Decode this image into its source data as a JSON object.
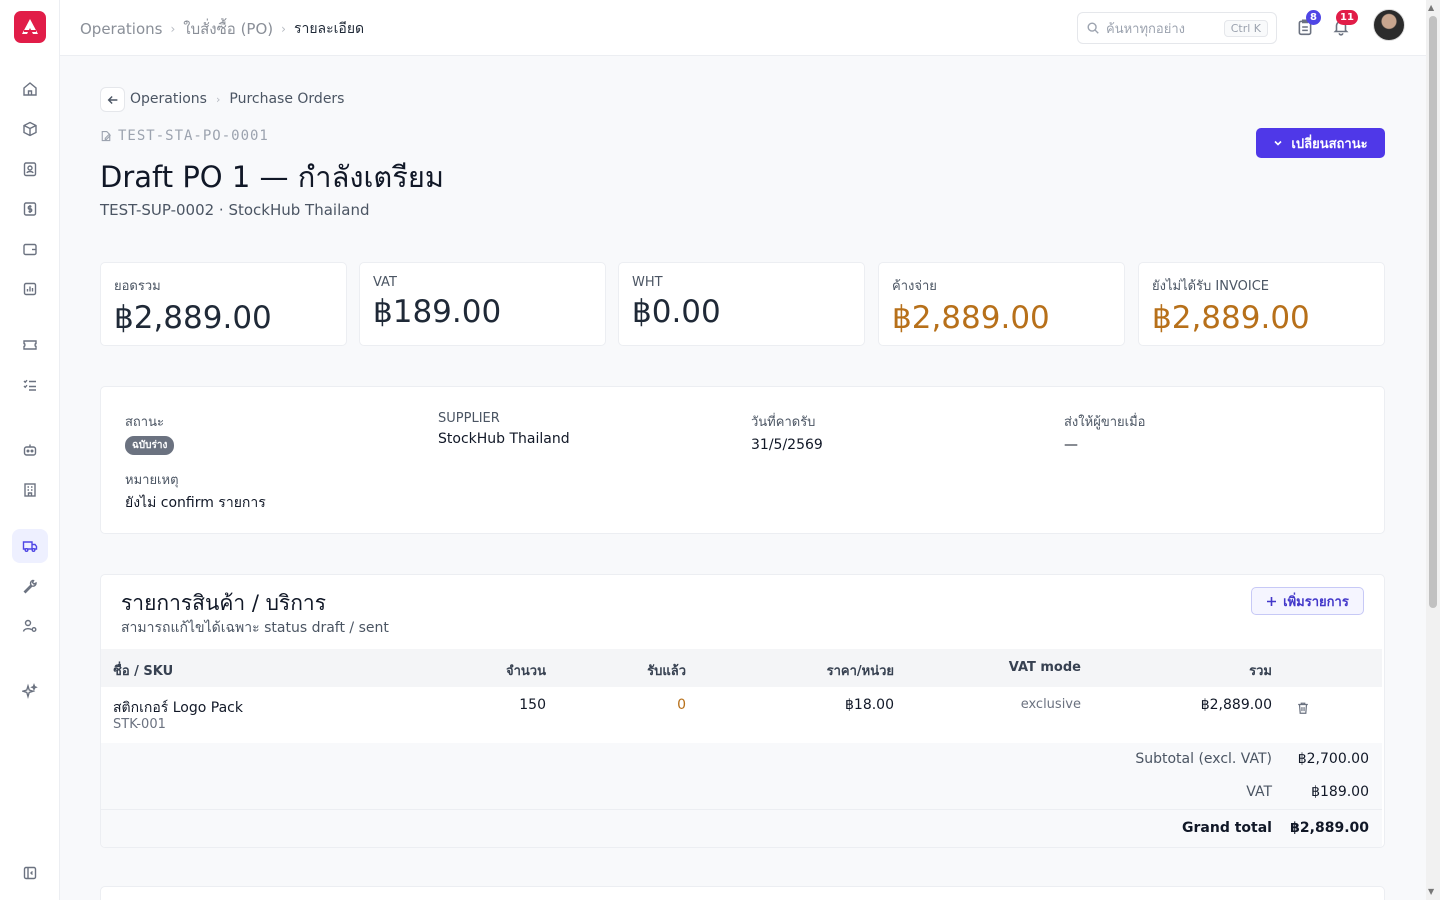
{
  "topbar": {
    "breadcrumbs": [
      "Operations",
      "ใบสั่งซื้อ (PO)",
      "รายละเอียด"
    ],
    "search_placeholder": "ค้นหาทุกอย่าง",
    "search_shortcut": "Ctrl K",
    "tasks_count": "8",
    "notifications_count": "11"
  },
  "page": {
    "sub_breadcrumbs": [
      "Operations",
      "Purchase Orders"
    ],
    "doc_number": "TEST-STA-PO-0001",
    "title": "Draft PO 1 — กำลังเตรียม",
    "subtitle": "TEST-SUP-0002 · StockHub Thailand",
    "change_status_label": "เปลี่ยนสถานะ"
  },
  "stats": [
    {
      "label": "ยอดรวม",
      "value": "฿2,889.00"
    },
    {
      "label": "VAT",
      "value": "฿189.00"
    },
    {
      "label": "WHT",
      "value": "฿0.00"
    },
    {
      "label": "ค้างจ่าย",
      "value": "฿2,889.00"
    },
    {
      "label": "ยังไม่ได้รับ INVOICE",
      "value": "฿2,889.00"
    }
  ],
  "info": {
    "status_label": "สถานะ",
    "status_value": "ฉบับร่าง",
    "supplier_label": "SUPPLIER",
    "supplier_value": "StockHub Thailand",
    "expected_label": "วันที่คาดรับ",
    "expected_value": "31/5/2569",
    "sent_label": "ส่งให้ผู้ขายเมื่อ",
    "sent_value": "—",
    "note_label": "หมายเหตุ",
    "note_value": "ยังไม่ confirm รายการ"
  },
  "items": {
    "title": "รายการสินค้า / บริการ",
    "subtitle": "สามารถแก้ไขได้เฉพาะ status draft / sent",
    "add_label": "เพิ่มรายการ",
    "headers": {
      "name": "ชื่อ / SKU",
      "qty": "จำนวน",
      "received": "รับแล้ว",
      "price": "ราคา/หน่วย",
      "vat_mode": "VAT mode",
      "total": "รวม"
    },
    "rows": [
      {
        "name": "สติกเกอร์ Logo Pack",
        "sku": "STK-001",
        "qty": "150",
        "received": "0",
        "price": "฿18.00",
        "vat_mode": "exclusive",
        "total": "฿2,889.00"
      }
    ],
    "subtotal_label": "Subtotal (excl. VAT)",
    "subtotal_value": "฿2,700.00",
    "vat_label": "VAT",
    "vat_value": "฿189.00",
    "grand_label": "Grand total",
    "grand_value": "฿2,889.00"
  },
  "colors": {
    "primary": "#4f38e8",
    "warning_amount": "#b7701a",
    "logo": "#e11d48"
  }
}
